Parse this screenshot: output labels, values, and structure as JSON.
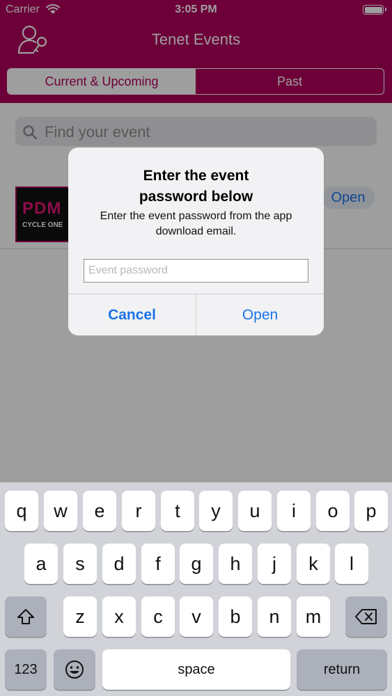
{
  "status_bar": {
    "carrier": "Carrier",
    "time": "3:05 PM"
  },
  "header": {
    "title": "Tenet Events"
  },
  "segments": {
    "current": "Current & Upcoming",
    "past": "Past"
  },
  "search": {
    "placeholder": "Find your event"
  },
  "event": {
    "thumb_title": "PDM",
    "thumb_subtitle": "CYCLE ONE",
    "open_label": "Open"
  },
  "alert": {
    "title_line1": "Enter the event",
    "title_line2": "password below",
    "message_line1": "Enter the event password from the app",
    "message_line2": "download email.",
    "input_placeholder": "Event password",
    "input_value": "",
    "cancel_label": "Cancel",
    "open_label": "Open"
  },
  "keyboard": {
    "row1": [
      "q",
      "w",
      "e",
      "r",
      "t",
      "y",
      "u",
      "i",
      "o",
      "p"
    ],
    "row2": [
      "a",
      "s",
      "d",
      "f",
      "g",
      "h",
      "j",
      "k",
      "l"
    ],
    "row3": [
      "z",
      "x",
      "c",
      "v",
      "b",
      "n",
      "m"
    ],
    "numbers_label": "123",
    "space_label": "space",
    "return_label": "return"
  },
  "colors": {
    "brand": "#B0005B",
    "link": "#1a73e8"
  }
}
